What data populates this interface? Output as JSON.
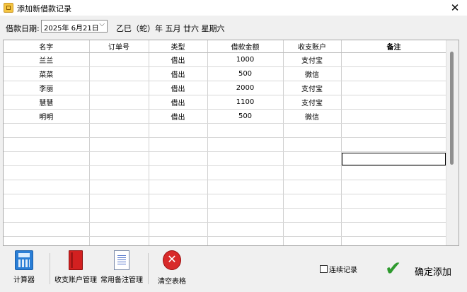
{
  "window": {
    "title": "添加新借款记录"
  },
  "datebar": {
    "label": "借款日期:",
    "date_value": "2025年  6月21日",
    "lunar_text": "乙巳（蛇）年  五月  廿六  星期六"
  },
  "table": {
    "columns": [
      "名字",
      "订单号",
      "类型",
      "借款金额",
      "收支账户",
      "备注"
    ],
    "rows": [
      [
        "兰兰",
        "",
        "借出",
        "1000",
        "支付宝",
        ""
      ],
      [
        "菜菜",
        "",
        "借出",
        "500",
        "微信",
        ""
      ],
      [
        "李丽",
        "",
        "借出",
        "2000",
        "支付宝",
        ""
      ],
      [
        "慧慧",
        "",
        "借出",
        "1100",
        "支付宝",
        ""
      ],
      [
        "明明",
        "",
        "借出",
        "500",
        "微信",
        ""
      ]
    ],
    "empty_rows": 9
  },
  "toolbar": {
    "calculator": "计算器",
    "account_mgmt": "收支账户管理",
    "remark_mgmt": "常用备注管理",
    "clear_table": "清空表格",
    "continuous": "连续记录",
    "confirm": "确定添加"
  },
  "icons": {
    "close": "close-icon",
    "calculator": "calculator-icon",
    "book": "account-book-icon",
    "document": "remark-document-icon",
    "clear": "clear-x-icon",
    "confirm": "green-check-icon"
  },
  "colors": {
    "accent_green": "#2e9a2e",
    "clear_red": "#d82a2a",
    "calc_blue": "#2a7ed6"
  }
}
